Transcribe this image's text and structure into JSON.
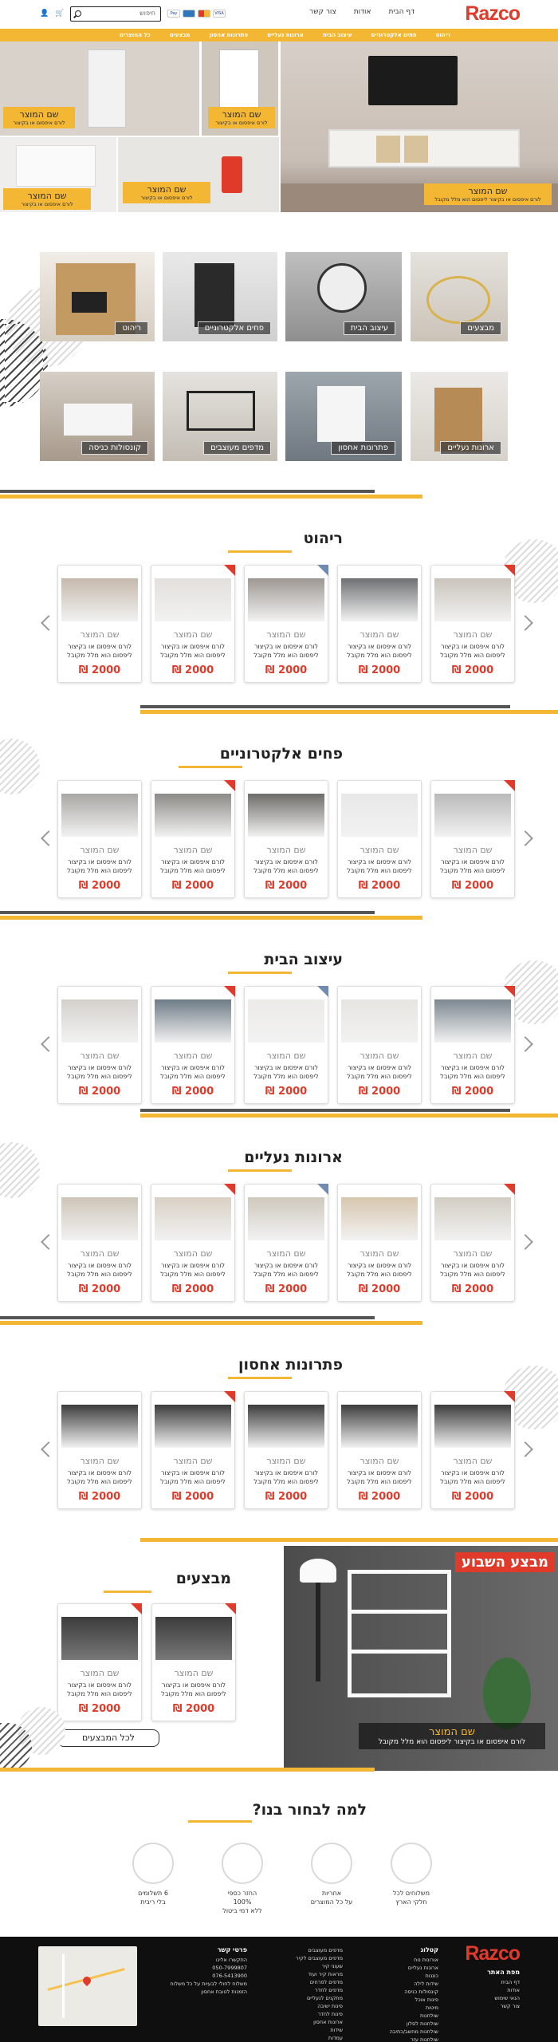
{
  "brand": {
    "logo": "Razco",
    "accent": "#f4b734",
    "red": "#e03a2a"
  },
  "topnav": [
    "דף הבית",
    "אודות",
    "צור קשר"
  ],
  "search": {
    "placeholder": "חיפוש"
  },
  "payment_icons": [
    "visa",
    "mastercard",
    "amex",
    "paypal"
  ],
  "header_icons": [
    "cart-icon",
    "user-icon"
  ],
  "categories_bar": [
    "ריהוט",
    "פחים אלקטרוניים",
    "עיצוב הבית",
    "ארונות נעליים",
    "פתרונות אחסון",
    "מבצעים",
    "כל המוצרים"
  ],
  "hero": {
    "main": {
      "name": "שם המוצר",
      "desc": "לורם איפסום או בקיצור ליפסום הוא מלל מקובל"
    },
    "small": [
      {
        "name": "שם המוצר",
        "desc": "לורם איפסום או בקיצור"
      },
      {
        "name": "שם המוצר",
        "desc": "לורם איפסום או בקיצור"
      },
      {
        "name": "שם המוצר",
        "desc": "לורם איפסום או בקיצור"
      },
      {
        "name": "שם המוצר",
        "desc": "לורם איפסום או בקיצור"
      }
    ]
  },
  "tiles": [
    "מבצעים",
    "עיצוב הבית",
    "פחים אלקטרוניים",
    "ריהוט",
    "ארונות נעליים",
    "פתרונות אחסון",
    "מדפים מעוצבים",
    "קונסולות כניסה"
  ],
  "product": {
    "name": "שם המוצר",
    "desc": "לורם איפסום או בקיצור ליפסום הוא מלל מקובל",
    "price": "2000 ₪"
  },
  "sections": [
    "ריהוט",
    "פחים אלקטרוניים",
    "עיצוב הבית",
    "ארונות נעליים",
    "פתרונות אחסון"
  ],
  "deals": {
    "title": "מבצעים",
    "week_label": "מבצע השבוע",
    "week_name": "שם המוצר",
    "week_desc": "לורם איפסום או בקיצור ליפסום הוא מלל מקובל",
    "all_button": "לכל המבצעים"
  },
  "why": {
    "title": "למה לבחור בנו?",
    "items": [
      {
        "line1": "משלוחים לכל",
        "line2": "חלקי הארץ",
        "line3": ""
      },
      {
        "line1": "אחריות",
        "line2": "על כל המוצרים",
        "line3": ""
      },
      {
        "line1": "החזר כספי",
        "line2": "100%",
        "line3": "ללא דמי ביטול"
      },
      {
        "line1": "6 תשלומים",
        "line2": "בלי ריבית",
        "line3": ""
      }
    ]
  },
  "footer": {
    "sitemap_title": "מפת האתר",
    "sitemap": [
      "דף הבית",
      "אודות",
      "הנאי שימוש",
      "צור קשר"
    ],
    "catalog_title": "קטלוג",
    "catalog": [
      "אורונות נוח",
      "ארונות נעליים",
      "כוננות",
      "שידות לילה",
      "קונסולות כניסה",
      "פינות אוכל",
      "מיטות",
      "שולחנות",
      "שולחנות לסלון",
      "שולחנות מחשב/כתיבה",
      "שולחנות עזר"
    ],
    "catalog2": [
      "מדפים מעוצבים",
      "מדפים מעוצבים לקיר",
      "שעוני קיר",
      "מראות קיר ועוד",
      "מדפים לפרחים",
      "מדפים לחדר",
      "מתקנים לנעליים",
      "פינות ישיבה",
      "פינות לחדר",
      "ארונות אחסון",
      "שידות",
      "עמדות"
    ],
    "contact_title": "פרטי קשר",
    "contact": [
      "התקשרו אלינו",
      "050-7999807",
      "076-5413900",
      "משלוח לחולי לבעיות על כל משלוח",
      "הזמנות לטובת אחסון"
    ]
  }
}
